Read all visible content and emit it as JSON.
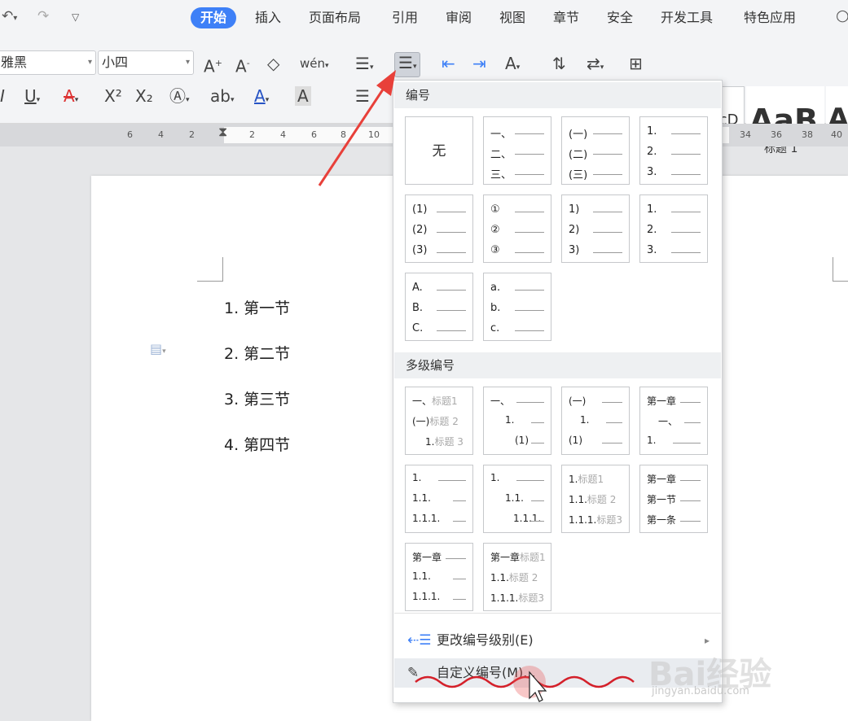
{
  "tabs": [
    "开始",
    "插入",
    "页面布局",
    "引用",
    "审阅",
    "视图",
    "章节",
    "安全",
    "开发工具",
    "特色应用"
  ],
  "toolbar": {
    "font_name": "雅黑",
    "font_size": "小四",
    "styles": {
      "normal_preview": "AaBbCcD",
      "heading_preview": "AaB",
      "heading_label": "标题 1",
      "cut_preview": "A"
    }
  },
  "ruler": [
    "6",
    "4",
    "2",
    "2",
    "4",
    "6",
    "8",
    "10",
    "34",
    "36",
    "38",
    "40"
  ],
  "document": {
    "paragraphs": [
      "1. 第一节",
      "2. 第二节",
      "3. 第三节",
      "4. 第四节"
    ]
  },
  "dropdown": {
    "numbering_title": "编号",
    "none_label": "无",
    "numbering_cells": [
      [
        "一、",
        "二、",
        "三、"
      ],
      [
        "(一)",
        "(二)",
        "(三)"
      ],
      [
        "1.",
        "2.",
        "3."
      ],
      [
        "(1)",
        "(2)",
        "(3)"
      ],
      [
        "①",
        "②",
        "③"
      ],
      [
        "1)",
        "2)",
        "3)"
      ],
      [
        "1.",
        "2.",
        "3."
      ],
      [
        "A.",
        "B.",
        "C."
      ],
      [
        "a.",
        "b.",
        "c."
      ]
    ],
    "multilevel_title": "多级编号",
    "multilevel_cells": [
      [
        [
          "一、",
          "标题1"
        ],
        [
          "(一)",
          "标题 2"
        ],
        [
          "1.",
          "标题 3"
        ]
      ],
      [
        [
          "一、",
          ""
        ],
        [
          "1.",
          ""
        ],
        [
          "(1)",
          ""
        ]
      ],
      [
        [
          "(一)",
          ""
        ],
        [
          "1.",
          ""
        ],
        [
          "(1)",
          ""
        ]
      ],
      [
        [
          "第一章",
          ""
        ],
        [
          "一、",
          ""
        ],
        [
          "1.",
          ""
        ]
      ],
      [
        [
          "1.",
          ""
        ],
        [
          "1.1.",
          ""
        ],
        [
          "1.1.1.",
          ""
        ]
      ],
      [
        [
          "1.",
          ""
        ],
        [
          "1.1.",
          ""
        ],
        [
          "1.1.1.",
          ""
        ]
      ],
      [
        [
          "1.",
          "标题1"
        ],
        [
          "1.1.",
          "标题 2"
        ],
        [
          "1.1.1.",
          "标题3"
        ]
      ],
      [
        [
          "第一章",
          ""
        ],
        [
          "第一节",
          ""
        ],
        [
          "第一条",
          ""
        ]
      ],
      [
        [
          "第一章",
          ""
        ],
        [
          "1.1.",
          ""
        ],
        [
          "1.1.1.",
          ""
        ]
      ],
      [
        [
          "第一章",
          "标题1"
        ],
        [
          "1.1.",
          "标题 2"
        ],
        [
          "1.1.1.",
          "标题3"
        ]
      ]
    ],
    "change_level_label": "更改编号级别(E)",
    "custom_label": "自定义编号(M)..."
  },
  "watermark": {
    "main": "Bai经验",
    "sub": "jingyan.baidu.com"
  },
  "colors": {
    "accent": "#3e80f7",
    "arrow": "#e8403a",
    "squiggle": "#d4202a"
  }
}
